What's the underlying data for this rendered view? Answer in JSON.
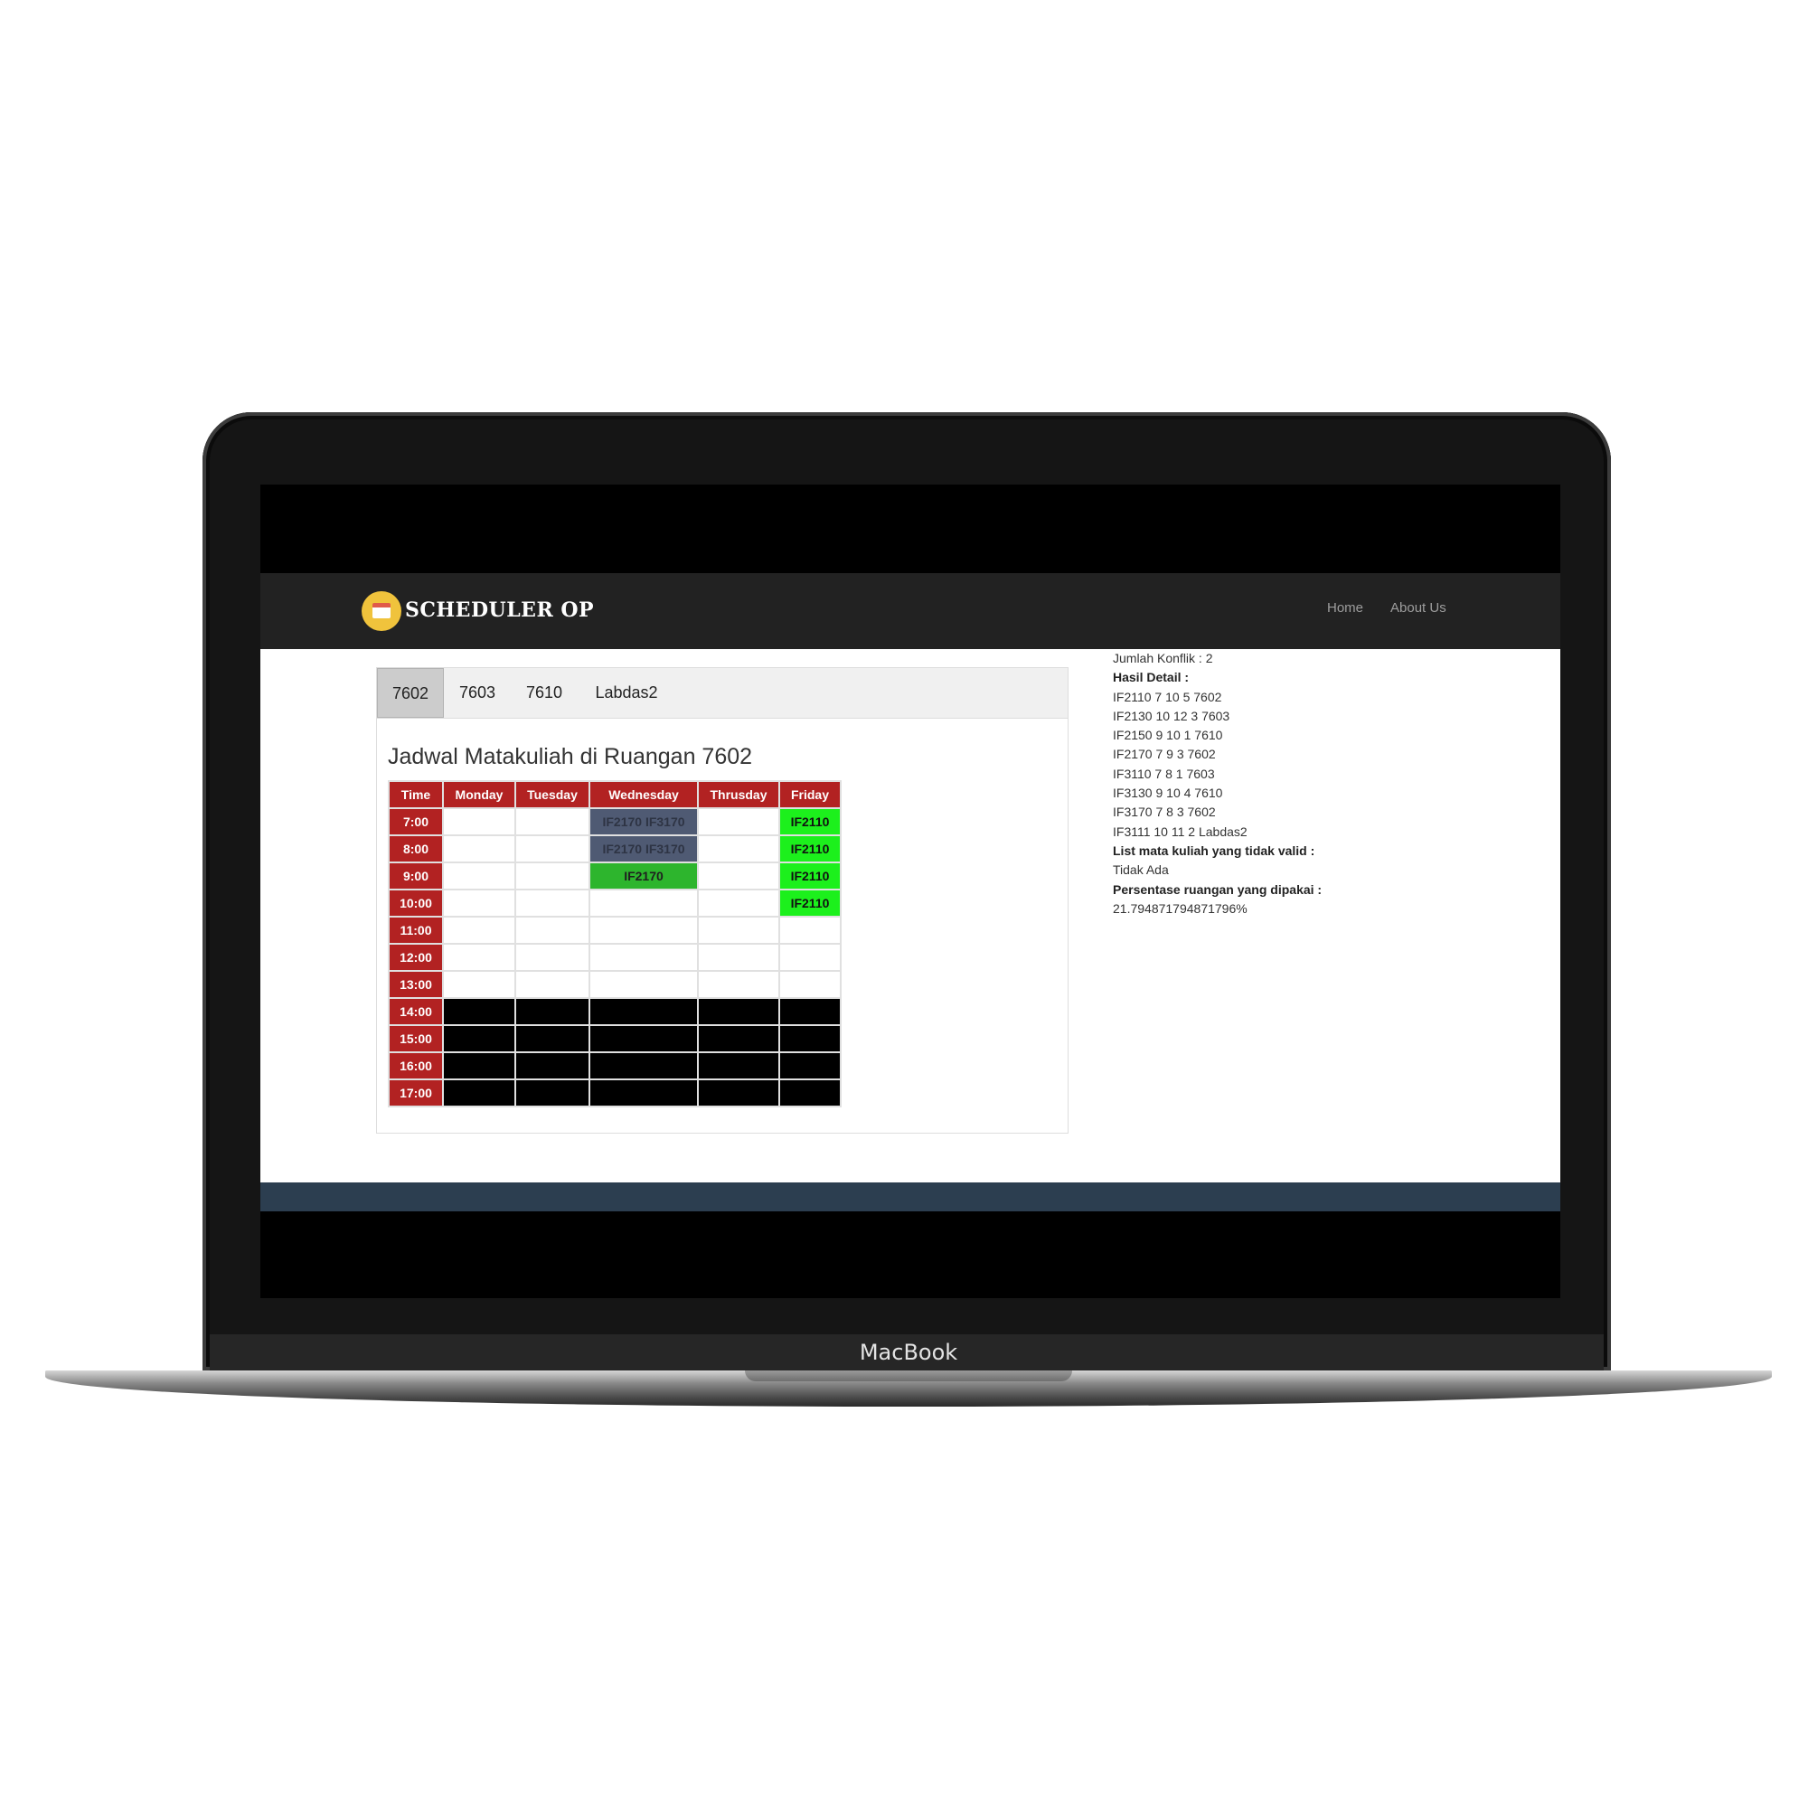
{
  "device": {
    "brand": "MacBook"
  },
  "navbar": {
    "logo_text": "SCHEDULER OP",
    "links": [
      "Home",
      "About Us"
    ]
  },
  "tabs": [
    {
      "label": "7602",
      "active": true
    },
    {
      "label": "7603",
      "active": false
    },
    {
      "label": "7610",
      "active": false
    },
    {
      "label": "Labdas2",
      "active": false
    }
  ],
  "schedule": {
    "title": "Jadwal Matakuliah di Ruangan 7602",
    "headers": [
      "Time",
      "Monday",
      "Tuesday",
      "Wednesday",
      "Thrusday",
      "Friday"
    ],
    "rows": [
      {
        "time": "7:00",
        "cells": [
          "",
          "",
          "IF2170 IF3170",
          "",
          "IF2110"
        ]
      },
      {
        "time": "8:00",
        "cells": [
          "",
          "",
          "IF2170 IF3170",
          "",
          "IF2110"
        ]
      },
      {
        "time": "9:00",
        "cells": [
          "",
          "",
          "IF2170",
          "",
          "IF2110"
        ]
      },
      {
        "time": "10:00",
        "cells": [
          "",
          "",
          "",
          "",
          "IF2110"
        ]
      },
      {
        "time": "11:00",
        "cells": [
          "",
          "",
          "",
          "",
          ""
        ]
      },
      {
        "time": "12:00",
        "cells": [
          "",
          "",
          "",
          "",
          ""
        ]
      },
      {
        "time": "13:00",
        "cells": [
          "",
          "",
          "",
          "",
          ""
        ]
      },
      {
        "time": "14:00",
        "cells": [
          "",
          "",
          "",
          "",
          ""
        ]
      },
      {
        "time": "15:00",
        "cells": [
          "",
          "",
          "",
          "",
          ""
        ]
      },
      {
        "time": "16:00",
        "cells": [
          "",
          "",
          "",
          "",
          ""
        ]
      },
      {
        "time": "17:00",
        "cells": [
          "",
          "",
          "",
          "",
          ""
        ]
      }
    ],
    "cell_styles": [
      [
        "empty",
        "empty",
        "gray",
        "empty",
        "lime"
      ],
      [
        "empty",
        "empty",
        "gray",
        "empty",
        "lime"
      ],
      [
        "empty",
        "empty",
        "green",
        "empty",
        "lime"
      ],
      [
        "empty",
        "empty",
        "empty",
        "empty",
        "lime"
      ],
      [
        "empty",
        "empty",
        "empty",
        "empty",
        "empty"
      ],
      [
        "empty",
        "empty",
        "empty",
        "empty",
        "empty"
      ],
      [
        "empty",
        "empty",
        "empty",
        "empty",
        "empty"
      ],
      [
        "black",
        "black",
        "black",
        "black",
        "black"
      ],
      [
        "black",
        "black",
        "black",
        "black",
        "black"
      ],
      [
        "black",
        "black",
        "black",
        "black",
        "black"
      ],
      [
        "black",
        "black",
        "black",
        "black",
        "black"
      ]
    ]
  },
  "info": {
    "conflicts": "Jumlah Konflik : 2",
    "detail_heading": "Hasil Detail :",
    "details": [
      "IF2110 7 10 5 7602",
      "IF2130 10 12 3 7603",
      "IF2150 9 10 1 7610",
      "IF2170 7 9 3 7602",
      "IF3110 7 8 1 7603",
      "IF3130 9 10 4 7610",
      "IF3170 7 8 3 7602",
      "IF3111 10 11 2 Labdas2"
    ],
    "invalid_heading": "List mata kuliah yang tidak valid :",
    "invalid_value": "Tidak Ada",
    "usage_heading": "Persentase ruangan yang dipakai :",
    "usage_value": "21.794871794871796%"
  },
  "colors": {
    "header_red": "#b22222",
    "navbar": "#222222",
    "footer": "#2c3e50",
    "conflict_gray": "#4f5a73",
    "course_green": "#2db52d",
    "course_lime": "#1cf01c",
    "blocked": "#000000"
  }
}
